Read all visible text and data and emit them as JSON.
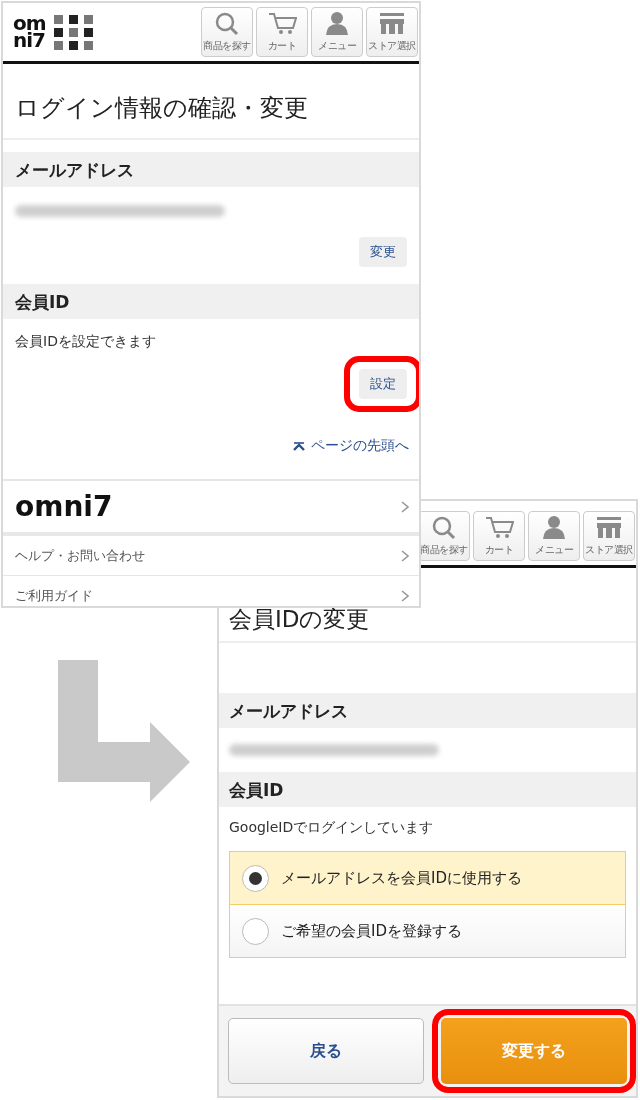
{
  "first_screen": {
    "header": {
      "logo_lines": [
        "om",
        "ni7"
      ],
      "nav": [
        {
          "label": "商品を探す",
          "kind": "search"
        },
        {
          "label": "カート",
          "kind": "cart"
        },
        {
          "label": "メニュー",
          "kind": "person"
        },
        {
          "label": "ストア選択",
          "kind": "store"
        }
      ]
    },
    "title": "ログイン情報の確認・変更",
    "sections": [
      {
        "heading": "メールアドレス",
        "redacted_value": true,
        "button": {
          "label": "変更",
          "highlighted": false
        }
      },
      {
        "heading": "会員ID",
        "text": "会員IDを設定できます",
        "button": {
          "label": "設定",
          "highlighted": true
        }
      }
    ],
    "page_top_link": "ページの先頭へ",
    "footer_links": [
      {
        "kind": "logo",
        "label": "omni7"
      },
      {
        "kind": "text",
        "label": "ヘルプ・お問い合わせ"
      },
      {
        "kind": "text",
        "label": "ご利用ガイド"
      }
    ]
  },
  "second_screen": {
    "header": {
      "nav": [
        {
          "label": "商品を探す",
          "kind": "search"
        },
        {
          "label": "カート",
          "kind": "cart"
        },
        {
          "label": "メニュー",
          "kind": "person"
        },
        {
          "label": "ストア選択",
          "kind": "store"
        }
      ]
    },
    "title": "会員IDの変更",
    "sections": [
      {
        "heading": "メールアドレス",
        "redacted_value": true
      },
      {
        "heading": "会員ID",
        "text": "GoogleIDでログインしています"
      }
    ],
    "options": [
      {
        "label": "メールアドレスを会員IDに使用する",
        "selected": true
      },
      {
        "label": "ご希望の会員IDを登録する",
        "selected": false
      }
    ],
    "buttons": [
      {
        "label": "戻る",
        "kind": "secondary",
        "highlighted": false
      },
      {
        "label": "変更する",
        "kind": "primary",
        "highlighted": true
      }
    ]
  }
}
